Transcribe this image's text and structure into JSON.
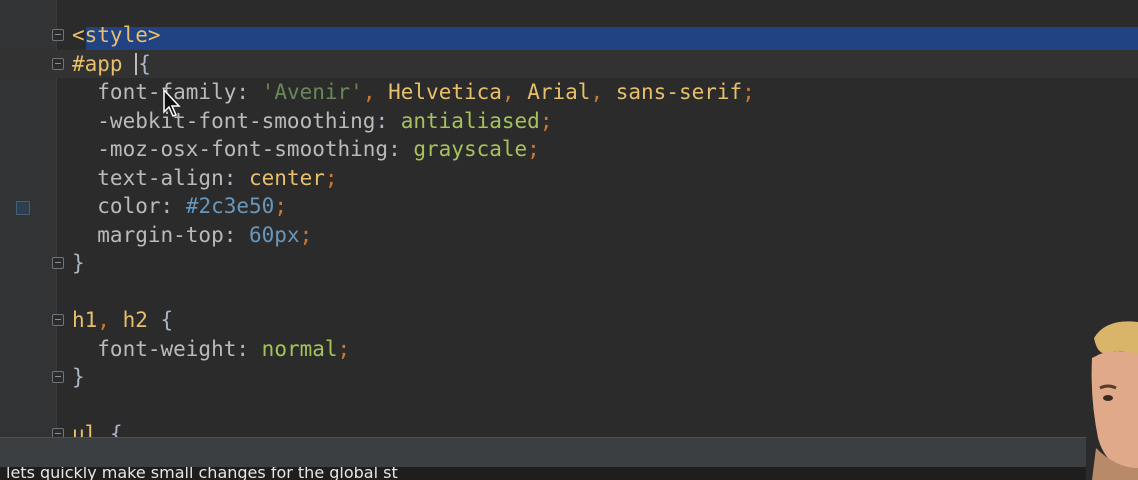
{
  "editor": {
    "lines": [
      {
        "tokens": [
          {
            "text": "<style>",
            "cls": "t-tag"
          }
        ]
      },
      {
        "tokens": [
          {
            "text": "#app ",
            "cls": "t-sel"
          },
          {
            "text": "{",
            "cls": "t-brace"
          }
        ]
      },
      {
        "tokens": [
          {
            "text": "  font-family",
            "cls": "t-prop"
          },
          {
            "text": ": ",
            "cls": "t-brace"
          },
          {
            "text": "'Avenir'",
            "cls": "t-str"
          },
          {
            "text": ", ",
            "cls": "t-pun"
          },
          {
            "text": "Helvetica",
            "cls": "t-val"
          },
          {
            "text": ", ",
            "cls": "t-pun"
          },
          {
            "text": "Arial",
            "cls": "t-val"
          },
          {
            "text": ", ",
            "cls": "t-pun"
          },
          {
            "text": "sans-serif",
            "cls": "t-val"
          },
          {
            "text": ";",
            "cls": "t-pun"
          }
        ]
      },
      {
        "tokens": [
          {
            "text": "  -webkit-font-smoothing",
            "cls": "t-prop"
          },
          {
            "text": ": ",
            "cls": "t-brace"
          },
          {
            "text": "antialiased",
            "cls": "t-kw"
          },
          {
            "text": ";",
            "cls": "t-pun"
          }
        ]
      },
      {
        "tokens": [
          {
            "text": "  -moz-osx-font-smoothing",
            "cls": "t-prop"
          },
          {
            "text": ": ",
            "cls": "t-brace"
          },
          {
            "text": "grayscale",
            "cls": "t-kw"
          },
          {
            "text": ";",
            "cls": "t-pun"
          }
        ]
      },
      {
        "tokens": [
          {
            "text": "  text-align",
            "cls": "t-prop"
          },
          {
            "text": ": ",
            "cls": "t-brace"
          },
          {
            "text": "center",
            "cls": "t-val"
          },
          {
            "text": ";",
            "cls": "t-pun"
          }
        ]
      },
      {
        "tokens": [
          {
            "text": "  color",
            "cls": "t-prop"
          },
          {
            "text": ": ",
            "cls": "t-brace"
          },
          {
            "text": "#2c3e50",
            "cls": "t-num"
          },
          {
            "text": ";",
            "cls": "t-pun"
          }
        ]
      },
      {
        "tokens": [
          {
            "text": "  margin-top",
            "cls": "t-prop"
          },
          {
            "text": ": ",
            "cls": "t-brace"
          },
          {
            "text": "60px",
            "cls": "t-num"
          },
          {
            "text": ";",
            "cls": "t-pun"
          }
        ]
      },
      {
        "tokens": [
          {
            "text": "}",
            "cls": "t-brace"
          }
        ]
      },
      {
        "tokens": []
      },
      {
        "tokens": [
          {
            "text": "h1",
            "cls": "t-sel"
          },
          {
            "text": ", ",
            "cls": "t-pun"
          },
          {
            "text": "h2 ",
            "cls": "t-sel"
          },
          {
            "text": "{",
            "cls": "t-brace"
          }
        ]
      },
      {
        "tokens": [
          {
            "text": "  font-weight",
            "cls": "t-prop"
          },
          {
            "text": ": ",
            "cls": "t-brace"
          },
          {
            "text": "normal",
            "cls": "t-kw"
          },
          {
            "text": ";",
            "cls": "t-pun"
          }
        ]
      },
      {
        "tokens": [
          {
            "text": "}",
            "cls": "t-brace"
          }
        ]
      },
      {
        "tokens": []
      },
      {
        "tokens": [
          {
            "text": "ul ",
            "cls": "t-sel"
          },
          {
            "text": "{",
            "cls": "t-brace"
          }
        ]
      }
    ],
    "selected_line": 0,
    "current_line": 1,
    "fold_markers": [
      0,
      1,
      8,
      10,
      12,
      14
    ],
    "color_swatch": "#2c3e50"
  },
  "caption": {
    "text": "lets quickly make small changes for the global st"
  },
  "colors": {
    "background": "#2b2b2b",
    "selection": "#214283",
    "gutter": "#313335",
    "statusbar": "#3c3f41"
  }
}
